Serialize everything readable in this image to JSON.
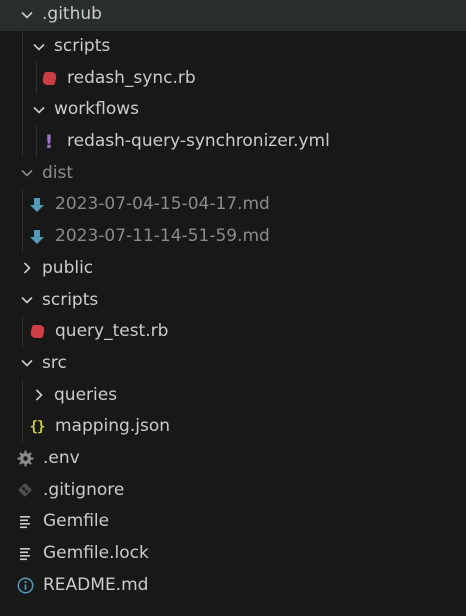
{
  "explorer": {
    "items": [
      {
        "label": ".github",
        "kind": "folder",
        "expanded": true,
        "dim": false
      },
      {
        "label": "scripts",
        "kind": "folder",
        "expanded": true,
        "dim": false
      },
      {
        "label": "redash_sync.rb",
        "kind": "file",
        "icon": "ruby-icon",
        "dim": false
      },
      {
        "label": "workflows",
        "kind": "folder",
        "expanded": true,
        "dim": false
      },
      {
        "label": "redash-query-synchronizer.yml",
        "kind": "file",
        "icon": "yaml-icon",
        "dim": false
      },
      {
        "label": "dist",
        "kind": "folder",
        "expanded": true,
        "dim": true
      },
      {
        "label": "2023-07-04-15-04-17.md",
        "kind": "file",
        "icon": "markdown-download-icon",
        "dim": true
      },
      {
        "label": "2023-07-11-14-51-59.md",
        "kind": "file",
        "icon": "markdown-download-icon",
        "dim": true
      },
      {
        "label": "public",
        "kind": "folder",
        "expanded": false,
        "dim": false
      },
      {
        "label": "scripts",
        "kind": "folder",
        "expanded": true,
        "dim": false
      },
      {
        "label": "query_test.rb",
        "kind": "file",
        "icon": "ruby-icon",
        "dim": false
      },
      {
        "label": "src",
        "kind": "folder",
        "expanded": true,
        "dim": false
      },
      {
        "label": "queries",
        "kind": "folder",
        "expanded": false,
        "dim": false
      },
      {
        "label": "mapping.json",
        "kind": "file",
        "icon": "json-icon",
        "dim": false
      },
      {
        "label": ".env",
        "kind": "file",
        "icon": "gear-icon",
        "dim": false
      },
      {
        "label": ".gitignore",
        "kind": "file",
        "icon": "git-icon",
        "dim": false
      },
      {
        "label": "Gemfile",
        "kind": "file",
        "icon": "lines-icon",
        "dim": false
      },
      {
        "label": "Gemfile.lock",
        "kind": "file",
        "icon": "lines-icon",
        "dim": false
      },
      {
        "label": "README.md",
        "kind": "file",
        "icon": "info-icon",
        "dim": false
      }
    ]
  },
  "colors": {
    "background": "#181818",
    "text": "#cccccc",
    "dimmed_text": "#8b8b8b",
    "ruby": "#cc3e44",
    "yaml": "#a074c4",
    "json": "#cbcb41",
    "markdown_download": "#519aba",
    "info": "#519aba",
    "config_icon": "#8c8c8c"
  }
}
